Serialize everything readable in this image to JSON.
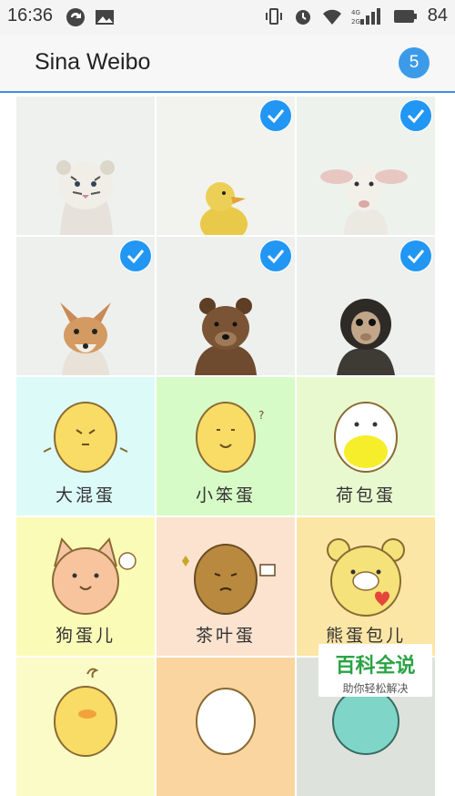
{
  "status_bar": {
    "time": "16:36",
    "battery": "84"
  },
  "app": {
    "title": "Sina Weibo",
    "selected_count": "5"
  },
  "grid": {
    "photos": [
      {
        "name": "white-tiger-cub",
        "selected": false,
        "bg": "#eef1ee"
      },
      {
        "name": "duckling",
        "selected": true,
        "bg": "#f2f3ee"
      },
      {
        "name": "lamb",
        "selected": true,
        "bg": "#eef2ec"
      },
      {
        "name": "fox-cub",
        "selected": true,
        "bg": "#eef0ee"
      },
      {
        "name": "bear-cub",
        "selected": true,
        "bg": "#eef0ee"
      },
      {
        "name": "monkey",
        "selected": true,
        "bg": "#eef0ee"
      }
    ],
    "stickers": [
      {
        "caption": "大混蛋",
        "bg": "#dcfbf8"
      },
      {
        "caption": "小笨蛋",
        "bg": "#d7fbc7"
      },
      {
        "caption": "荷包蛋",
        "bg": "#e8f9cf"
      },
      {
        "caption": "狗蛋儿",
        "bg": "#fbfbb8"
      },
      {
        "caption": "茶叶蛋",
        "bg": "#fbe3cf"
      },
      {
        "caption": "熊蛋包儿",
        "bg": "#fbe6a6"
      },
      {
        "caption": "",
        "bg": "#fbfbc8"
      },
      {
        "caption": "",
        "bg": "#fbd59f"
      },
      {
        "caption": "",
        "bg": "#dde3dc"
      }
    ]
  },
  "watermark": {
    "title": "百科全说",
    "subtitle": "助你轻松解决"
  },
  "colors": {
    "accent": "#2196f3",
    "header_line": "#3f8fe0"
  }
}
